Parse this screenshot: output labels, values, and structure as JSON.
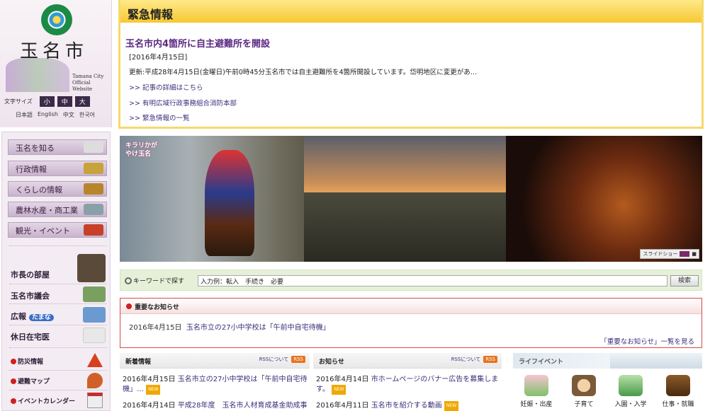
{
  "logo": {
    "city_name": "玉名市",
    "en_line1": "Tamana City",
    "en_line2": "Official Website"
  },
  "font_size": {
    "label": "文字サイズ",
    "small": "小",
    "medium": "中",
    "large": "大"
  },
  "languages": [
    "日本語",
    "English",
    "中文",
    "한국어"
  ],
  "nav_main": [
    {
      "label": "玉名を知る",
      "icon": "crane-icon"
    },
    {
      "label": "行政情報",
      "icon": "building-icon"
    },
    {
      "label": "くらしの情報",
      "icon": "family-icon"
    },
    {
      "label": "農林水産・商工業",
      "icon": "factory-icon"
    },
    {
      "label": "観光・イベント",
      "icon": "festival-icon"
    }
  ],
  "nav_sub": [
    {
      "label": "市長の部屋",
      "icon": "mayor-photo-icon"
    },
    {
      "label": "玉名市議会",
      "icon": "council-icon"
    },
    {
      "label": "広報",
      "extra": "たまな",
      "icon": "magazine-icon"
    },
    {
      "label": "休日在宅医",
      "icon": "doctor-icon"
    }
  ],
  "nav_small": [
    {
      "label": "防災情報",
      "icon": "warning-icon"
    },
    {
      "label": "避難マップ",
      "icon": "map-icon"
    },
    {
      "label": "イベントカレンダー",
      "icon": "calendar-icon"
    }
  ],
  "emergency": {
    "heading": "緊急情報",
    "title": "玉名市内4箇所に自主避難所を開設",
    "date": "[2016年4月15日]",
    "body": "更新:平成28年4月15日(金曜日)午前0時45分玉名市では自主避難所を4箇所開設しています。岱明地区に変更があ…",
    "links": [
      ">> 記事の詳細はこちら",
      ">> 有明広域行政事務組合消防本部",
      ">> 緊急情報の一覧"
    ]
  },
  "banner": {
    "badge": "キラリかがやけ玉名",
    "slideshow_label": "スライドショー"
  },
  "search": {
    "label": "キーワードで探す",
    "value": "入力例：転入　手続き　必要",
    "button": "検索"
  },
  "important": {
    "heading": "重要なお知らせ",
    "item_date": "2016年4月15日",
    "item_link": "玉名市立の27小中学校は「午前中自宅待機」",
    "more": "「重要なお知らせ」一覧を見る"
  },
  "news": {
    "heading": "新着情報",
    "rss_label": "RSSについて",
    "rss": "RSS",
    "items": [
      {
        "date": "2016年4月15日",
        "title": "玉名市立の27小中学校は「午前中自宅待機」…",
        "new": "NEW"
      },
      {
        "date": "2016年4月14日",
        "title": "平成28年度　玉名市人材育成基金助成事",
        "new": ""
      }
    ]
  },
  "notices": {
    "heading": "お知らせ",
    "rss_label": "RSSについて",
    "rss": "RSS",
    "items": [
      {
        "date": "2016年4月14日",
        "title": "市ホームページのバナー広告を募集します。",
        "new": "NEW"
      },
      {
        "date": "2016年4月11日",
        "title": "玉名市を紹介する動画",
        "new": "NEW"
      }
    ]
  },
  "life": {
    "heading": "ライフイベント",
    "items": [
      {
        "label": "妊娠・出産",
        "icon": "pregnancy-icon"
      },
      {
        "label": "子育て",
        "icon": "parenting-icon"
      },
      {
        "label": "入園・入学",
        "icon": "school-icon"
      },
      {
        "label": "仕事・就職",
        "icon": "briefcase-icon"
      }
    ]
  }
}
